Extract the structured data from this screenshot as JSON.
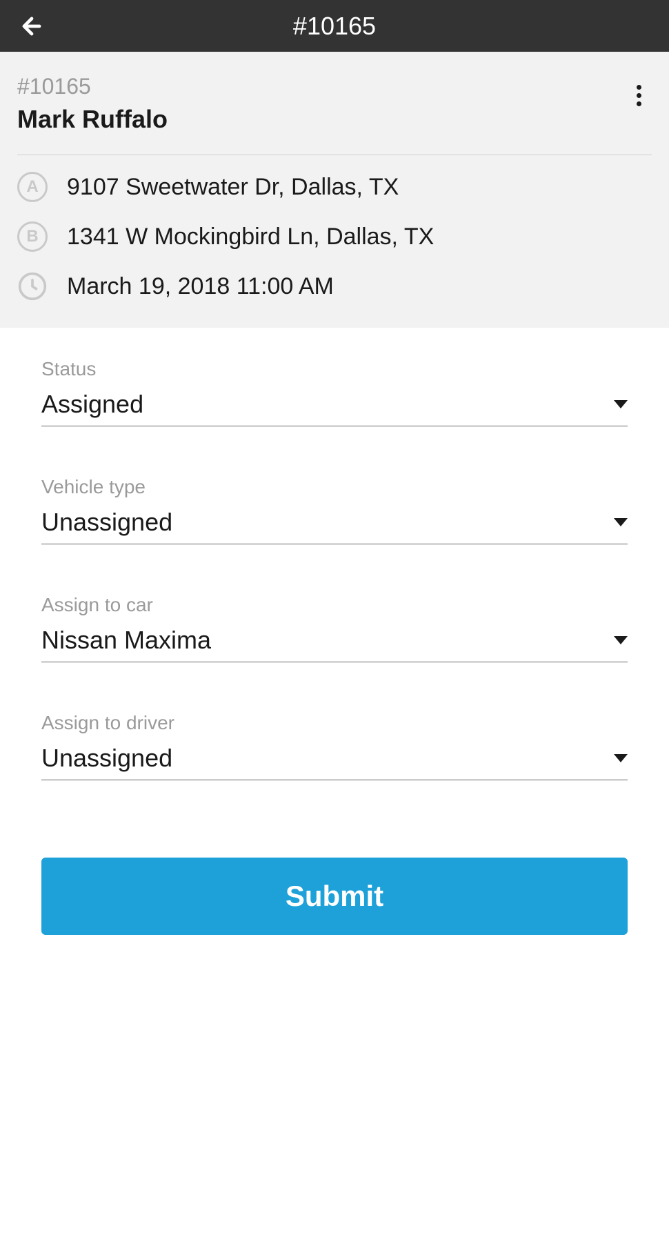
{
  "header": {
    "title": "#10165"
  },
  "info": {
    "order_id": "#10165",
    "customer_name": "Mark Ruffalo",
    "badge_a": "A",
    "badge_b": "B",
    "address_a": "9107 Sweetwater Dr, Dallas, TX",
    "address_b": "1341 W Mockingbird Ln, Dallas, TX",
    "datetime": "March 19, 2018 11:00 AM"
  },
  "form": {
    "status": {
      "label": "Status",
      "value": "Assigned"
    },
    "vehicle_type": {
      "label": "Vehicle type",
      "value": "Unassigned"
    },
    "assign_car": {
      "label": "Assign to car",
      "value": "Nissan Maxima"
    },
    "assign_driver": {
      "label": "Assign to driver",
      "value": "Unassigned"
    },
    "submit_label": "Submit"
  }
}
